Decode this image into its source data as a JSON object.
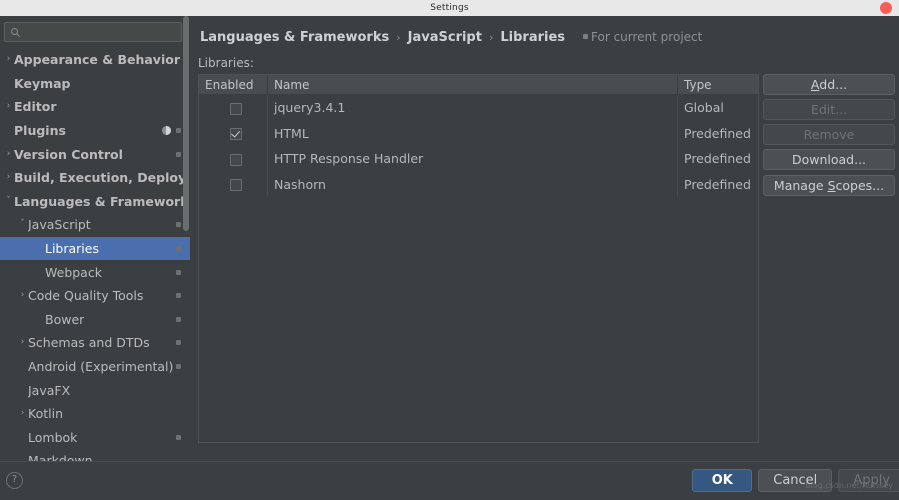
{
  "window": {
    "title": "Settings",
    "close_icon": "close-dot-icon"
  },
  "search": {
    "placeholder": "",
    "value": "",
    "icon": "search-icon"
  },
  "sidebar": {
    "items": [
      {
        "label": "Appearance & Behavior",
        "level": 0,
        "arrow": "›",
        "expanded": false,
        "selected": false,
        "badge": false
      },
      {
        "label": "Keymap",
        "level": 0,
        "arrow": "",
        "expanded": false,
        "selected": false,
        "badge": false
      },
      {
        "label": "Editor",
        "level": 0,
        "arrow": "›",
        "expanded": false,
        "selected": false,
        "badge": false
      },
      {
        "label": "Plugins",
        "level": 0,
        "arrow": "",
        "expanded": false,
        "selected": false,
        "badge": true,
        "plugins_icon": true
      },
      {
        "label": "Version Control",
        "level": 0,
        "arrow": "›",
        "expanded": false,
        "selected": false,
        "badge": true
      },
      {
        "label": "Build, Execution, Deploym",
        "level": 0,
        "arrow": "›",
        "expanded": false,
        "selected": false,
        "badge": false
      },
      {
        "label": "Languages & Frameworks",
        "level": 0,
        "arrow": "ˇ",
        "expanded": true,
        "selected": false,
        "badge": false
      },
      {
        "label": "JavaScript",
        "level": 1,
        "arrow": "ˇ",
        "expanded": true,
        "selected": false,
        "badge": true
      },
      {
        "label": "Libraries",
        "level": 2,
        "arrow": "",
        "expanded": false,
        "selected": true,
        "badge": true
      },
      {
        "label": "Webpack",
        "level": 2,
        "arrow": "",
        "expanded": false,
        "selected": false,
        "badge": true
      },
      {
        "label": "Code Quality Tools",
        "level": 1,
        "arrow": "›",
        "expanded": false,
        "selected": false,
        "badge": true
      },
      {
        "label": "Bower",
        "level": 2,
        "arrow": "",
        "expanded": false,
        "selected": false,
        "badge": true
      },
      {
        "label": "Schemas and DTDs",
        "level": 1,
        "arrow": "›",
        "expanded": false,
        "selected": false,
        "badge": true
      },
      {
        "label": "Android (Experimental)",
        "level": 1,
        "arrow": "",
        "expanded": false,
        "selected": false,
        "badge": true
      },
      {
        "label": "JavaFX",
        "level": 1,
        "arrow": "",
        "expanded": false,
        "selected": false,
        "badge": false
      },
      {
        "label": "Kotlin",
        "level": 1,
        "arrow": "›",
        "expanded": false,
        "selected": false,
        "badge": false
      },
      {
        "label": "Lombok",
        "level": 1,
        "arrow": "",
        "expanded": false,
        "selected": false,
        "badge": true
      },
      {
        "label": "Markdown",
        "level": 1,
        "arrow": "",
        "expanded": false,
        "selected": false,
        "badge": false
      }
    ]
  },
  "breadcrumb": {
    "crumbs": [
      "Languages & Frameworks",
      "JavaScript",
      "Libraries"
    ],
    "separator": "›",
    "scope_note": "For current project",
    "scope_icon": "project-scope-icon"
  },
  "main": {
    "section_label": "Libraries:",
    "table": {
      "columns": [
        "Enabled",
        "Name",
        "Type"
      ],
      "rows": [
        {
          "enabled": false,
          "name": "jquery3.4.1",
          "type": "Global"
        },
        {
          "enabled": true,
          "name": "HTML",
          "type": "Predefined"
        },
        {
          "enabled": false,
          "name": "HTTP Response Handler",
          "type": "Predefined"
        },
        {
          "enabled": false,
          "name": "Nashorn",
          "type": "Predefined"
        }
      ]
    },
    "buttons": [
      {
        "label": "Add...",
        "mnemonic": "A",
        "disabled": false,
        "spaced": false
      },
      {
        "label": "Edit...",
        "mnemonic": "",
        "disabled": true,
        "spaced": false
      },
      {
        "label": "Remove",
        "mnemonic": "",
        "disabled": true,
        "spaced": false
      },
      {
        "label": "Download...",
        "mnemonic": "",
        "disabled": false,
        "spaced": false
      },
      {
        "label": "Manage Scopes...",
        "mnemonic": "S",
        "disabled": false,
        "spaced": true
      }
    ]
  },
  "footer": {
    "help_label": "?",
    "ok_label": "OK",
    "cancel_label": "Cancel",
    "apply_label": "Apply",
    "watermark": "blog.csdn.net/Ruiskey"
  },
  "colors": {
    "background": "#3c3f41",
    "selection": "#4b6eaf",
    "primary_button": "#365880",
    "close_button": "#fc5c54",
    "text": "#bbbbbb"
  }
}
